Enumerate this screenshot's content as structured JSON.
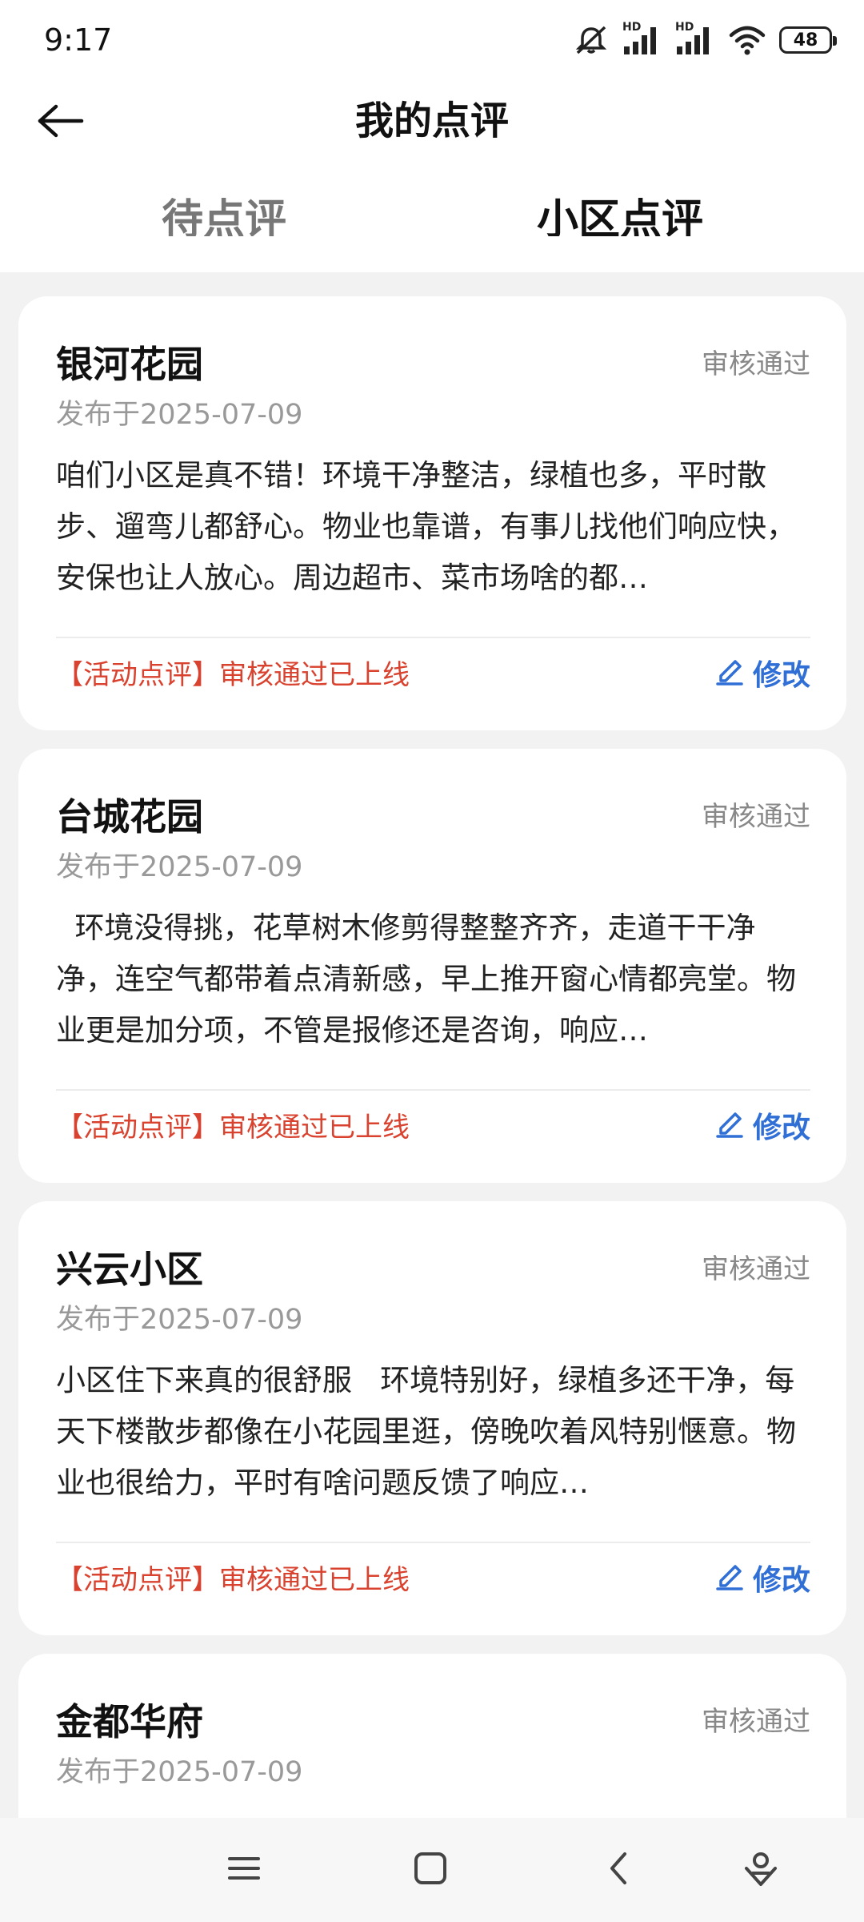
{
  "status_bar": {
    "time": "9:17",
    "battery": "48",
    "signal_label_1": "HD",
    "signal_label_2": "HD",
    "icons": [
      "mute-icon",
      "signal-icon",
      "signal-icon",
      "wifi-icon",
      "battery-icon"
    ]
  },
  "header": {
    "title": "我的点评",
    "back_icon": "arrow-left-icon"
  },
  "tabs": [
    {
      "label": "待点评",
      "active": false
    },
    {
      "label": "小区点评",
      "active": true
    }
  ],
  "colors": {
    "accent_blue": "#2f6fd6",
    "tag_red": "#d9422e",
    "status_gray": "#888888"
  },
  "reviews": [
    {
      "name": "银河花园",
      "status": "审核通过",
      "date": "发布于2025-07-09",
      "content": "咱们小区是真不错！环境干净整洁，绿植也多，平时散步、遛弯儿都舒心。物业也靠谱，有事儿找他们响应快，安保也让人放心。周边超市、菜市场啥的都…",
      "tag": "【活动点评】审核通过已上线",
      "edit_label": "修改"
    },
    {
      "name": "台城花园",
      "status": "审核通过",
      "date": "发布于2025-07-09",
      "content": "  环境没得挑，花草树木修剪得整整齐齐，走道干干净净，连空气都带着点清新感，早上推开窗心情都亮堂。物业更是加分项，不管是报修还是咨询，响应…",
      "tag": "【活动点评】审核通过已上线",
      "edit_label": "修改"
    },
    {
      "name": "兴云小区",
      "status": "审核通过",
      "date": "发布于2025-07-09",
      "content": "小区住下来真的很舒服   环境特别好，绿植多还干净，每天下楼散步都像在小花园里逛，傍晚吹着风特别惬意。物业也很给力，平时有啥问题反馈了响应…",
      "tag": "【活动点评】审核通过已上线",
      "edit_label": "修改"
    },
    {
      "name": "金都华府",
      "status": "审核通过",
      "date": "发布于2025-07-09",
      "content": "",
      "tag": "",
      "edit_label": ""
    }
  ],
  "nav_bar": {
    "icons": [
      "menu-icon",
      "home-square-icon",
      "back-chevron-icon",
      "assistant-icon"
    ]
  }
}
